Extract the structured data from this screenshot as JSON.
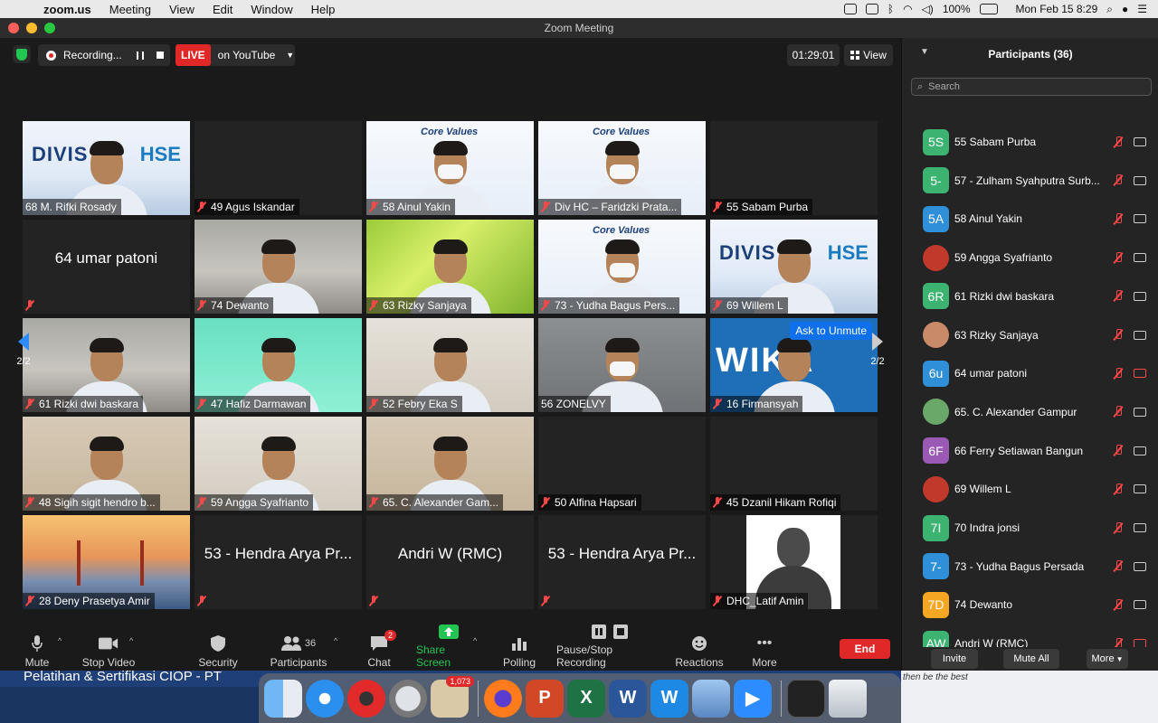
{
  "menubar": {
    "app": "zoom.us",
    "items": [
      "Meeting",
      "View",
      "Edit",
      "Window",
      "Help"
    ],
    "battery": "100%",
    "datetime": "Mon Feb 15  8:29"
  },
  "window": {
    "title": "Zoom Meeting"
  },
  "topbar": {
    "recording_label": "Recording...",
    "live_badge": "LIVE",
    "live_target": "on YouTube",
    "timer": "01:29:01",
    "view_label": "View"
  },
  "grid": {
    "page_indicator": "2/2",
    "tiles": [
      {
        "name": "68 M. Rifki Rosady",
        "muted": false,
        "style": "banner"
      },
      {
        "name": "49 Agus Iskandar",
        "muted": true,
        "style": "dark"
      },
      {
        "name": "58 Ainul Yakin",
        "muted": true,
        "style": "core"
      },
      {
        "name": "Div HC – Faridzki Prata...",
        "muted": true,
        "style": "core"
      },
      {
        "name": "55 Sabam Purba",
        "muted": true,
        "style": "dark"
      },
      {
        "name": "",
        "big_name": "64 umar patoni",
        "muted": true,
        "style": "dark"
      },
      {
        "name": "74 Dewanto",
        "muted": true,
        "style": "room"
      },
      {
        "name": "63 Rizky Sanjaya",
        "muted": true,
        "style": "green"
      },
      {
        "name": "73 - Yudha Bagus Pers...",
        "muted": true,
        "style": "core"
      },
      {
        "name": "69 Willem L",
        "muted": true,
        "style": "banner"
      },
      {
        "name": "61 Rizki dwi baskara",
        "muted": true,
        "style": "room"
      },
      {
        "name": "47 Hafiz Darmawan",
        "muted": true,
        "style": "mint"
      },
      {
        "name": "52 Febry Eka S",
        "muted": true,
        "style": "wall"
      },
      {
        "name": "56 ZONELVY",
        "muted": false,
        "style": "grey"
      },
      {
        "name": "16 Firmansyah",
        "muted": true,
        "style": "wika",
        "tag": "Ask to Unmute"
      },
      {
        "name": "48 Sigih sigit hendro b...",
        "muted": true,
        "style": "beige"
      },
      {
        "name": "59 Angga Syafrianto",
        "muted": true,
        "style": "wall"
      },
      {
        "name": "65. C. Alexander Gam...",
        "muted": true,
        "style": "beige"
      },
      {
        "name": "50 Alfina Hapsari",
        "muted": true,
        "style": "dark"
      },
      {
        "name": "45 Dzanil Hikam Rofiqi",
        "muted": true,
        "style": "dark"
      },
      {
        "name": "28 Deny Prasetya Amir",
        "muted": true,
        "style": "bridge"
      },
      {
        "name": "",
        "big_name": "53 - Hendra Arya Pr...",
        "muted": true,
        "style": "dark"
      },
      {
        "name": "",
        "big_name": "Andri W (RMC)",
        "muted": true,
        "style": "dark"
      },
      {
        "name": "",
        "big_name": "53 - Hendra Arya Pr...",
        "muted": true,
        "style": "dark"
      },
      {
        "name": "DHC_Latif Amin",
        "muted": true,
        "style": "portrait"
      }
    ],
    "banner_words": [
      "DIVIS",
      "HSE"
    ],
    "core_title": "Core Values",
    "wika_word": "WIKA"
  },
  "toolbar": {
    "mute": "Mute",
    "stop_video": "Stop Video",
    "security": "Security",
    "participants": "Participants",
    "participants_count": "36",
    "chat": "Chat",
    "chat_badge": "2",
    "share_screen": "Share Screen",
    "polling": "Polling",
    "pause_stop_recording": "Pause/Stop Recording",
    "reactions": "Reactions",
    "more": "More",
    "end": "End"
  },
  "panel": {
    "title": "Participants (36)",
    "search_placeholder": "Search",
    "participants": [
      {
        "initials": "5S",
        "name": "55 Sabam Purba",
        "color": "#3cb371",
        "cam_off": false
      },
      {
        "initials": "5-",
        "name": "57 - Zulham Syahputra Surb...",
        "color": "#3cb371",
        "cam_off": false
      },
      {
        "initials": "5A",
        "name": "58 Ainul Yakin",
        "color": "#2f8fd8",
        "cam_off": false
      },
      {
        "initials": "",
        "name": "59 Angga Syafrianto",
        "color": "#c0392b",
        "cam_off": false
      },
      {
        "initials": "6R",
        "name": "61 Rizki dwi baskara",
        "color": "#3cb371",
        "cam_off": false
      },
      {
        "initials": "",
        "name": "63 Rizky Sanjaya",
        "color": "#c98a6a",
        "cam_off": false
      },
      {
        "initials": "6u",
        "name": "64 umar patoni",
        "color": "#2f8fd8",
        "cam_off": true
      },
      {
        "initials": "",
        "name": "65. C. Alexander Gampur",
        "color": "#6aa86a",
        "cam_off": false
      },
      {
        "initials": "6F",
        "name": "66 Ferry Setiawan Bangun",
        "color": "#9b59b6",
        "cam_off": false
      },
      {
        "initials": "",
        "name": "69 Willem L",
        "color": "#c0392b",
        "cam_off": false
      },
      {
        "initials": "7I",
        "name": "70 Indra jonsi",
        "color": "#3cb371",
        "cam_off": false
      },
      {
        "initials": "7-",
        "name": "73 - Yudha Bagus Persada",
        "color": "#2f8fd8",
        "cam_off": false
      },
      {
        "initials": "7D",
        "name": "74 Dewanto",
        "color": "#f5a623",
        "cam_off": false
      },
      {
        "initials": "AW",
        "name": "Andri W (RMC)",
        "color": "#3cb371",
        "cam_off": true
      }
    ],
    "invite": "Invite",
    "mute_all": "Mute All",
    "more": "More"
  },
  "desktop": {
    "banner_text": "Pelatihan & Sertifikasi  CIOP - PT",
    "side_text": "then be the best",
    "dock_badge": "1,073"
  }
}
